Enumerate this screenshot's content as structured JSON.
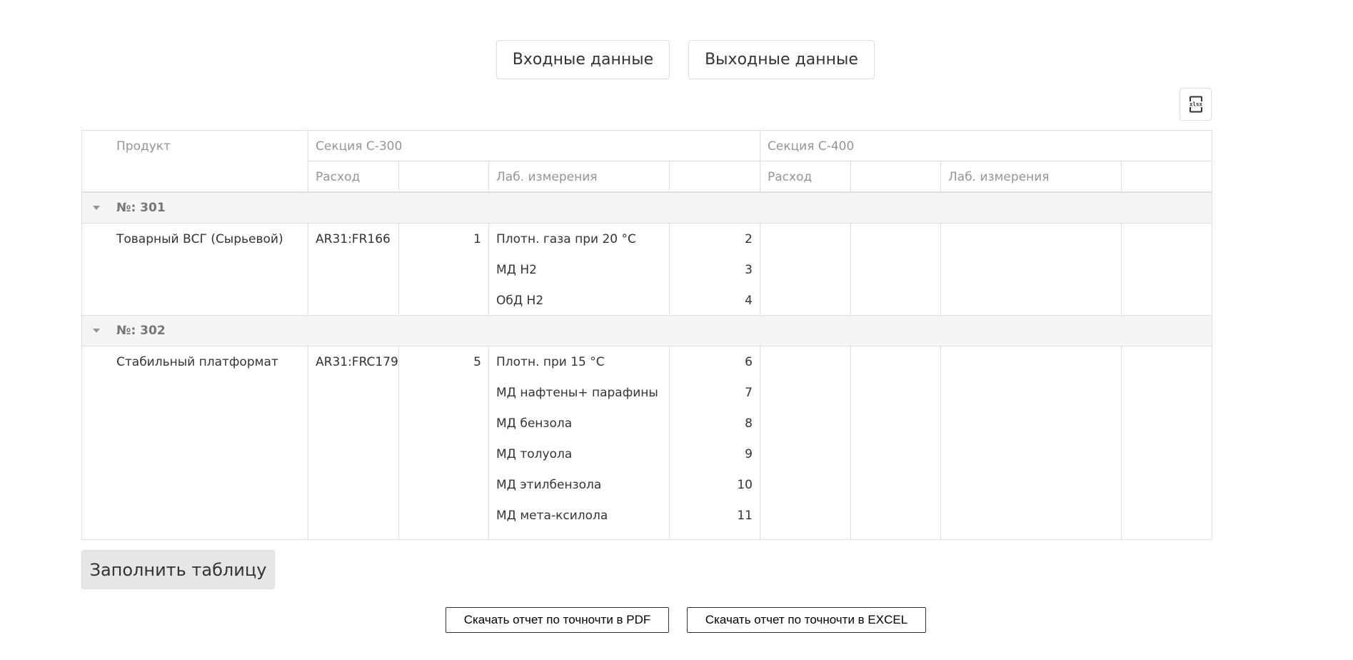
{
  "tabs": {
    "input_label": "Входные данные",
    "output_label": "Выходные данные"
  },
  "export_button": {
    "icon": "xlsx-icon",
    "icon_text": "xlsx"
  },
  "table": {
    "headers": {
      "product": "Продукт",
      "section_300": "Секция С-300",
      "section_400": "Секция С-400",
      "s300_flow": "Расход",
      "s300_lab": "Лаб. измерения",
      "s400_flow": "Расход",
      "s400_lab": "Лаб. измерения"
    },
    "groups": [
      {
        "label": "№: 301",
        "product": "Товарный ВСГ (Сырьевой)",
        "flow_tag": "AR31:FR166",
        "flow_value": "1",
        "lab": [
          {
            "name": "Плотн. газа при 20 °С",
            "value": "2"
          },
          {
            "name": "МД Н2",
            "value": "3"
          },
          {
            "name": "ОбД Н2",
            "value": "4"
          }
        ]
      },
      {
        "label": "№: 302",
        "product": "Стабильный платформат",
        "flow_tag": "AR31:FRC179",
        "flow_value": "5",
        "lab": [
          {
            "name": "Плотн. при 15 °С",
            "value": "6"
          },
          {
            "name": "МД нафтены+ парафины",
            "value": "7"
          },
          {
            "name": "МД бензола",
            "value": "8"
          },
          {
            "name": "МД толуола",
            "value": "9"
          },
          {
            "name": "МД этилбензола",
            "value": "10"
          },
          {
            "name": "МД мета-ксилола",
            "value": "11"
          }
        ]
      }
    ]
  },
  "fill_button_label": "Заполнить таблицу",
  "downloads": {
    "pdf_label": "Скачать отчет по точночти в PDF",
    "excel_label": "Скачать отчет по точночти в EXCEL"
  }
}
